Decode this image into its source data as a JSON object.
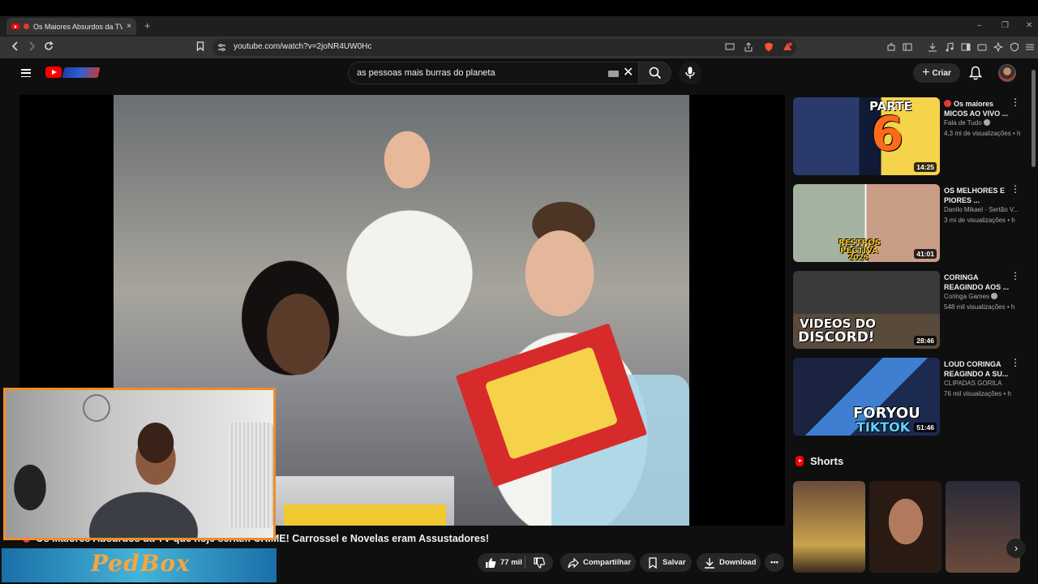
{
  "browser": {
    "tab_title": "Os Maiores Absurdos da TV",
    "tab_close": "×",
    "new_tab": "+",
    "url": "youtube.com/watch?v=2joNR4UW0Hc",
    "win_controls": [
      "–",
      "❐",
      "✕"
    ]
  },
  "header": {
    "search_value": "as pessoas mais burras do planeta",
    "create_label": "Criar"
  },
  "video": {
    "title": "Os Maiores Absurdos da TV que hoje seriam CRIME! Carrossel e Novelas eram Assustadores!",
    "like_count": "77 mil",
    "share_label": "Compartilhar",
    "save_label": "Salvar",
    "download_label": "Download",
    "more_label": "•••",
    "overlay_banner": "PedBox"
  },
  "sidebar": {
    "items": [
      {
        "title": "Os maiores MICOS AO VIVO ...",
        "live_dot": true,
        "channel": "Fala de Tudo",
        "verified": true,
        "meta": "4,3 mi de visualizações • h",
        "duration": "14:25",
        "thumb_text": [
          "PARTE",
          "6"
        ]
      },
      {
        "title": "OS MELHORES E PIORES ...",
        "live_dot": false,
        "channel": "Danilo Mikael - Sertão V...",
        "verified": false,
        "meta": "3 mi de visualizações • h",
        "duration": "41:01",
        "thumb_text": [
          "RESTROS",
          "PECTIVA",
          "2025"
        ]
      },
      {
        "title": "CORINGA REAGINDO AOS ...",
        "live_dot": false,
        "channel": "Coringa Games",
        "verified": true,
        "meta": "548 mil visualizações • h",
        "duration": "28:46",
        "thumb_text": [
          "VIDEOS DO",
          "DISCORD!"
        ]
      },
      {
        "title": "LOUD CORINGA REAGINDO A SU...",
        "live_dot": false,
        "channel": "CLIPADAS GORILA",
        "verified": false,
        "meta": "76 mil visualizações • h",
        "duration": "51:46",
        "thumb_text": [
          "FORYOU",
          "TIKTOK"
        ]
      }
    ],
    "kebab": "⋮",
    "shorts_label": "Shorts",
    "next_arrow": "›"
  },
  "colors": {
    "webcam_border": "#f08d2a",
    "yt_red": "#ff0000",
    "banner_text": "#f5a640"
  }
}
